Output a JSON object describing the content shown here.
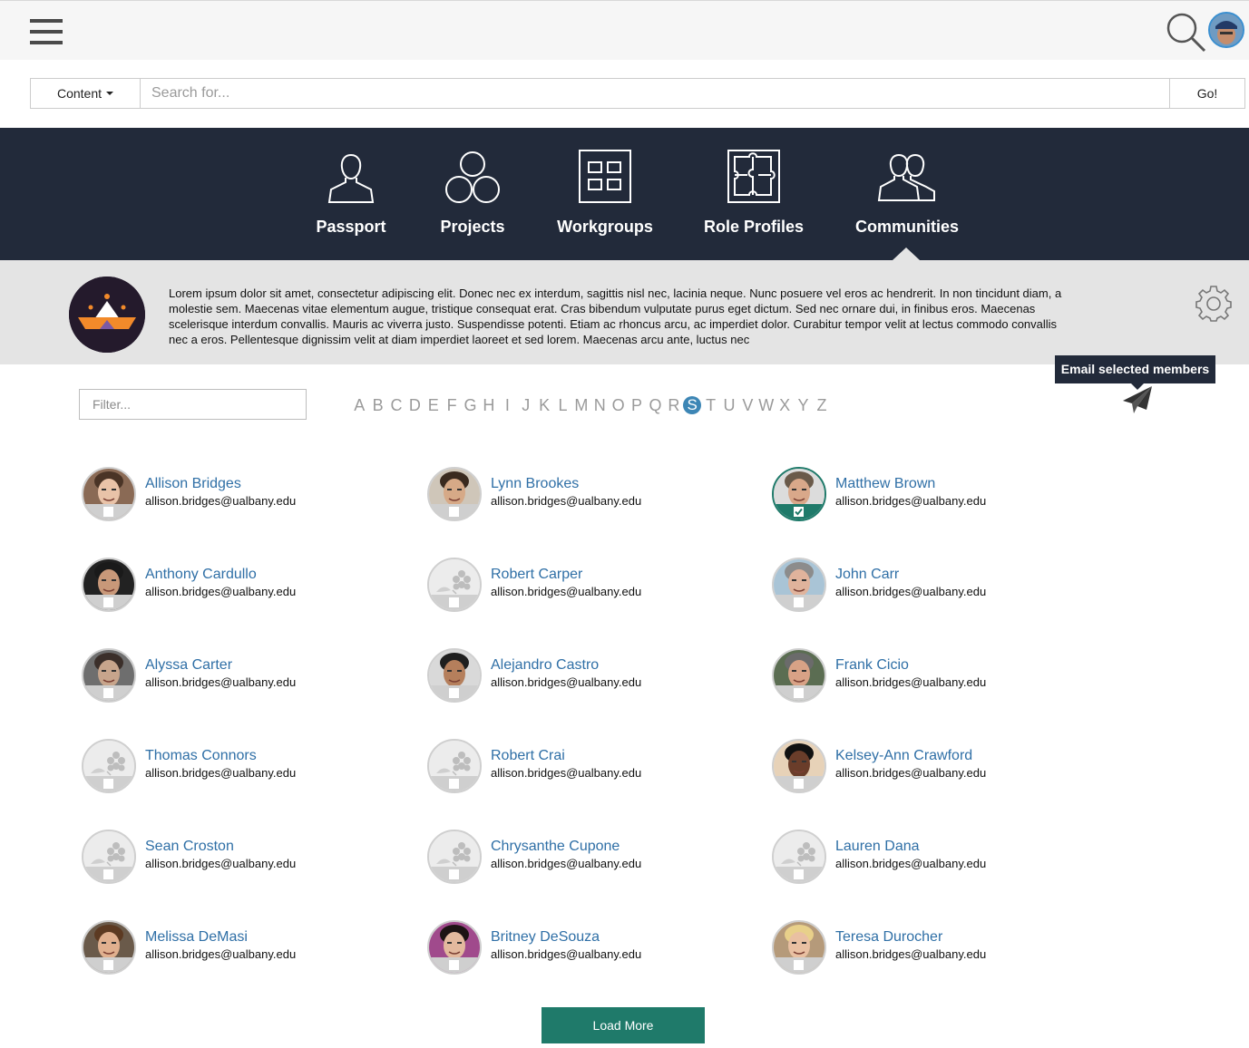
{
  "header": {
    "menu_icon": "hamburger-menu-icon",
    "search_icon": "magnifier-icon",
    "avatar_icon": "user-avatar"
  },
  "search": {
    "scope_label": "Content",
    "placeholder": "Search for...",
    "go_label": "Go!"
  },
  "nav": {
    "items": [
      {
        "label": "Passport",
        "icon": "person-icon"
      },
      {
        "label": "Projects",
        "icon": "circles-icon"
      },
      {
        "label": "Workgroups",
        "icon": "grid-icon"
      },
      {
        "label": "Role Profiles",
        "icon": "puzzle-icon"
      },
      {
        "label": "Communities",
        "icon": "group-icon",
        "active": true
      }
    ]
  },
  "community": {
    "description": "Lorem ipsum dolor sit amet, consectetur adipiscing elit. Donec nec ex interdum, sagittis nisl nec, lacinia neque. Nunc posuere vel eros ac hendrerit. In non tincidunt diam, a molestie sem. Maecenas vitae elementum augue, tristique consequat erat. Cras bibendum vulputate purus eget dictum. Sed nec ornare dui, in finibus eros. Maecenas scelerisque interdum convallis. Mauris ac viverra justo. Suspendisse potenti. Etiam ac rhoncus arcu, ac imperdiet dolor. Curabitur tempor velit at lectus commodo convallis nec a eros. Pellentesque dignissim velit at diam imperdiet laoreet et sed lorem. Maecenas arcu ante, luctus nec",
    "settings_icon": "gear-icon"
  },
  "actions": {
    "tooltip": "Email selected members",
    "send_icon": "paper-plane-icon"
  },
  "filter": {
    "placeholder": "Filter..."
  },
  "alphabet": {
    "letters": [
      "A",
      "B",
      "C",
      "D",
      "E",
      "F",
      "G",
      "H",
      "I",
      "J",
      "K",
      "L",
      "M",
      "N",
      "O",
      "P",
      "Q",
      "R",
      "S",
      "T",
      "U",
      "V",
      "W",
      "X",
      "Y",
      "Z"
    ],
    "active": "S"
  },
  "members": [
    {
      "name": "Allison Bridges",
      "email": "allison.bridges@ualbany.edu",
      "photo": "woman-light",
      "selected": false
    },
    {
      "name": "Lynn Brookes",
      "email": "allison.bridges@ualbany.edu",
      "photo": "woman-tan",
      "selected": false
    },
    {
      "name": "Matthew Brown",
      "email": "allison.bridges@ualbany.edu",
      "photo": "man-glasses",
      "selected": true
    },
    {
      "name": "Anthony Cardullo",
      "email": "allison.bridges@ualbany.edu",
      "photo": "man-dark",
      "selected": false
    },
    {
      "name": "Robert Carper",
      "email": "allison.bridges@ualbany.edu",
      "photo": "placeholder",
      "selected": false
    },
    {
      "name": "John Carr",
      "email": "allison.bridges@ualbany.edu",
      "photo": "man-grey",
      "selected": false
    },
    {
      "name": "Alyssa Carter",
      "email": "allison.bridges@ualbany.edu",
      "photo": "woman-blur",
      "selected": false
    },
    {
      "name": "Alejandro Castro",
      "email": "allison.bridges@ualbany.edu",
      "photo": "man-suit",
      "selected": false
    },
    {
      "name": "Frank Cicio",
      "email": "allison.bridges@ualbany.edu",
      "photo": "man-outdoor",
      "selected": false
    },
    {
      "name": "Thomas Connors",
      "email": "allison.bridges@ualbany.edu",
      "photo": "placeholder",
      "selected": false
    },
    {
      "name": "Robert Crai",
      "email": "allison.bridges@ualbany.edu",
      "photo": "placeholder",
      "selected": false
    },
    {
      "name": "Kelsey-Ann Crawford",
      "email": "allison.bridges@ualbany.edu",
      "photo": "woman-dark",
      "selected": false
    },
    {
      "name": "Sean Croston",
      "email": "allison.bridges@ualbany.edu",
      "photo": "placeholder",
      "selected": false
    },
    {
      "name": "Chrysanthe Cupone",
      "email": "allison.bridges@ualbany.edu",
      "photo": "placeholder",
      "selected": false
    },
    {
      "name": "Lauren Dana",
      "email": "allison.bridges@ualbany.edu",
      "photo": "placeholder",
      "selected": false
    },
    {
      "name": "Melissa DeMasi",
      "email": "allison.bridges@ualbany.edu",
      "photo": "woman-brown",
      "selected": false
    },
    {
      "name": "Britney DeSouza",
      "email": "allison.bridges@ualbany.edu",
      "photo": "woman-pink",
      "selected": false
    },
    {
      "name": "Teresa Durocher",
      "email": "allison.bridges@ualbany.edu",
      "photo": "woman-blonde",
      "selected": false
    }
  ],
  "load_more_label": "Load More",
  "colors": {
    "nav_bg": "#222a3a",
    "link": "#2f6fa6",
    "accent": "#1f7a6a",
    "alpha_active": "#3d86b5"
  }
}
